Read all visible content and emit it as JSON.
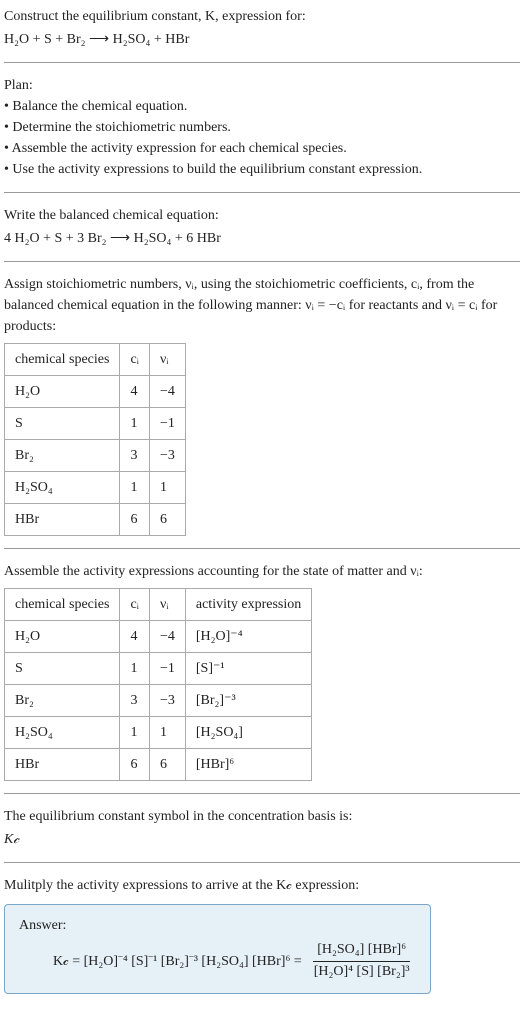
{
  "header": {
    "prompt_line1": "Construct the equilibrium constant, K, expression for:",
    "equation": "H₂O + S + Br₂ ⟶ H₂SO₄ + HBr"
  },
  "plan": {
    "heading": "Plan:",
    "items": [
      "• Balance the chemical equation.",
      "• Determine the stoichiometric numbers.",
      "• Assemble the activity expression for each chemical species.",
      "• Use the activity expressions to build the equilibrium constant expression."
    ]
  },
  "balanced": {
    "label": "Write the balanced chemical equation:",
    "equation": "4 H₂O + S + 3 Br₂ ⟶ H₂SO₄ + 6 HBr"
  },
  "stoich": {
    "intro_part1": "Assign stoichiometric numbers, νᵢ, using the stoichiometric coefficients, cᵢ, from the balanced chemical equation in the following manner: νᵢ = −cᵢ for reactants and νᵢ = cᵢ for products:",
    "headers": {
      "c1": "chemical species",
      "c2": "cᵢ",
      "c3": "νᵢ"
    },
    "rows": [
      {
        "sp": "H₂O",
        "c": "4",
        "v": "−4"
      },
      {
        "sp": "S",
        "c": "1",
        "v": "−1"
      },
      {
        "sp": "Br₂",
        "c": "3",
        "v": "−3"
      },
      {
        "sp": "H₂SO₄",
        "c": "1",
        "v": "1"
      },
      {
        "sp": "HBr",
        "c": "6",
        "v": "6"
      }
    ]
  },
  "activity": {
    "intro": "Assemble the activity expressions accounting for the state of matter and νᵢ:",
    "headers": {
      "c1": "chemical species",
      "c2": "cᵢ",
      "c3": "νᵢ",
      "c4": "activity expression"
    },
    "rows": [
      {
        "sp": "H₂O",
        "c": "4",
        "v": "−4",
        "ae": "[H₂O]⁻⁴"
      },
      {
        "sp": "S",
        "c": "1",
        "v": "−1",
        "ae": "[S]⁻¹"
      },
      {
        "sp": "Br₂",
        "c": "3",
        "v": "−3",
        "ae": "[Br₂]⁻³"
      },
      {
        "sp": "H₂SO₄",
        "c": "1",
        "v": "1",
        "ae": "[H₂SO₄]"
      },
      {
        "sp": "HBr",
        "c": "6",
        "v": "6",
        "ae": "[HBr]⁶"
      }
    ]
  },
  "kc_statement": {
    "line1": "The equilibrium constant symbol in the concentration basis is:",
    "symbol": "K𝒸"
  },
  "multiply": {
    "line": "Mulitply the activity expressions to arrive at the K𝒸 expression:"
  },
  "answer": {
    "label": "Answer:",
    "lhs": "K𝒸 = [H₂O]⁻⁴ [S]⁻¹ [Br₂]⁻³ [H₂SO₄] [HBr]⁶ =",
    "frac_num": "[H₂SO₄] [HBr]⁶",
    "frac_den": "[H₂O]⁴ [S] [Br₂]³"
  }
}
